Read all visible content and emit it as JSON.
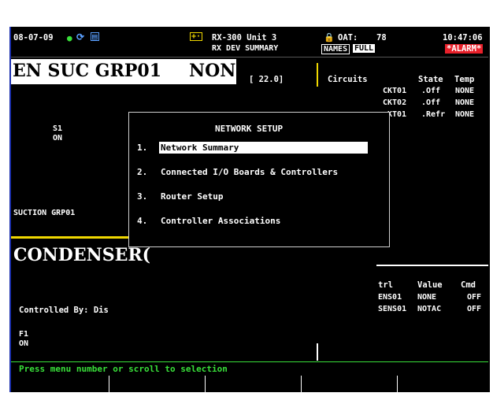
{
  "header": {
    "date": "08-07-09",
    "unit_title": "RX-300 Unit 3",
    "screen_name": "RX DEV SUMMARY",
    "oat_label": "OAT:",
    "oat_value": "78",
    "time": "10:47:06",
    "names_label": "NAMES",
    "full_label": "FULL",
    "alarm_label": "*ALARM*"
  },
  "suction_panel": {
    "title": "EN SUC GRP01",
    "status": "NONE",
    "value": "[ 22.0]",
    "s1_label": "S1",
    "s1_state": "ON",
    "group_label": "SUCTION GRP01"
  },
  "circuits": {
    "header": "Circuits",
    "state_header": "State",
    "temp_header": "Temp",
    "rows": [
      {
        "name": "CKT01",
        "state": ".Off",
        "temp": "NONE"
      },
      {
        "name": "CKT02",
        "state": ".Off",
        "temp": "NONE"
      },
      {
        "name": "KT01",
        "state": ".Refr",
        "temp": "NONE"
      }
    ]
  },
  "condenser": {
    "title": "CONDENSER(",
    "controlled_by": "Controlled By: Dis",
    "f1_label": "F1",
    "f1_state": "ON",
    "table_header_ctrl": "trl",
    "table_header_value": "Value",
    "table_header_cmd": "Cmd",
    "rows": [
      {
        "name": "ENS01",
        "value": "NONE",
        "cmd": "OFF"
      },
      {
        "name": "SENS01",
        "value": "NOTAC",
        "cmd": "OFF"
      }
    ]
  },
  "popup": {
    "title": "NETWORK SETUP",
    "items": [
      {
        "num": "1.",
        "label": "Network Summary"
      },
      {
        "num": "2.",
        "label": "Connected I/O Boards & Controllers"
      },
      {
        "num": "3.",
        "label": "Router Setup"
      },
      {
        "num": "4.",
        "label": "Controller Associations"
      }
    ]
  },
  "status_bar": {
    "message": "Press menu number or scroll to selection"
  },
  "colors": {
    "status_green": "#39e03a",
    "divider_yellow": "#f0d800",
    "alarm_red": "#e8202a"
  }
}
